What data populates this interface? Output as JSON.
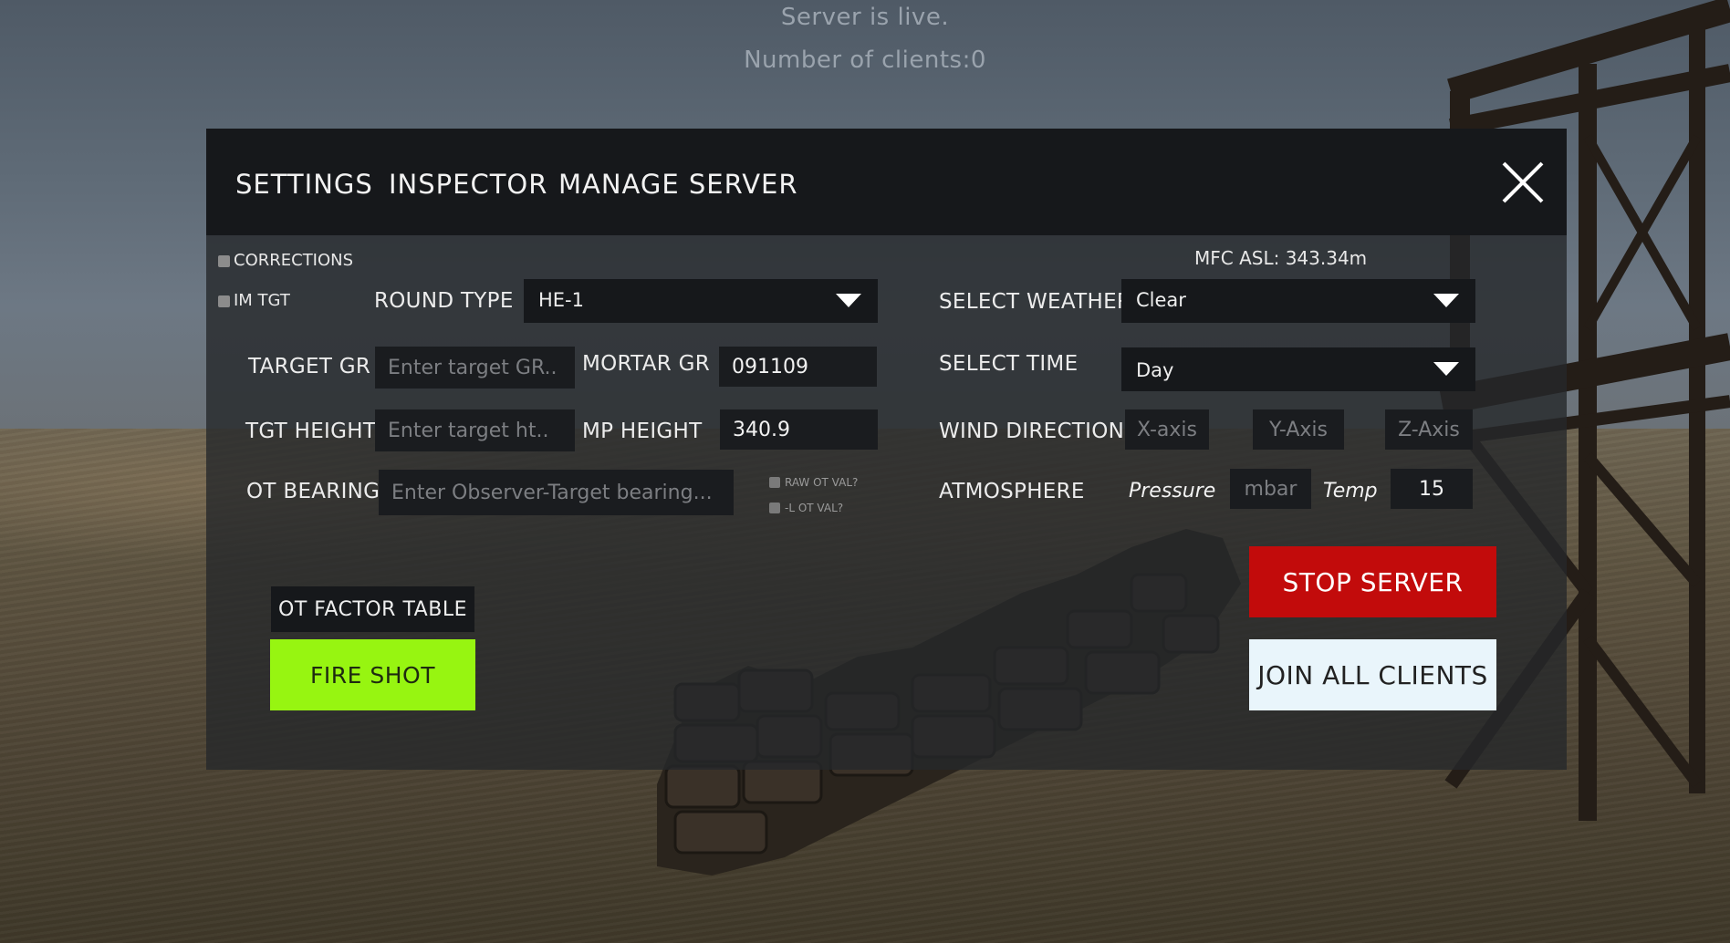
{
  "server": {
    "status": "Server is live.",
    "clients": "Number of clients:0"
  },
  "tabs": {
    "settings": "SETTINGS",
    "inspector": "INSPECTOR",
    "manage_server": "MANAGE SERVER"
  },
  "left": {
    "corrections_label": "CORRECTIONS",
    "im_tgt_label": "IM TGT",
    "round_type_label": "ROUND TYPE",
    "round_type_value": "HE-1",
    "target_gr_label": "TARGET GR",
    "target_gr_placeholder": "Enter target GR..",
    "mortar_gr_label": "MORTAR GR",
    "mortar_gr_value": "091109",
    "tgt_height_label": "TGT HEIGHT",
    "tgt_height_placeholder": "Enter target ht..",
    "mp_height_label": "MP HEIGHT",
    "mp_height_value": "340.9",
    "ot_bearing_label": "OT BEARING",
    "ot_bearing_placeholder": "Enter Observer-Target bearing...",
    "raw_ot_val_label": "RAW OT VAL?",
    "l_ot_val_label": "-L OT VAL?"
  },
  "right": {
    "mfc_asl": "MFC ASL: 343.34m",
    "select_weather_label": "SELECT WEATHER",
    "weather_value": "Clear",
    "select_time_label": "SELECT TIME",
    "time_value": "Day",
    "wind_direction_label": "WIND DIRECTION",
    "wind_x_placeholder": "X-axis",
    "wind_y_placeholder": "Y-Axis",
    "wind_z_placeholder": "Z-Axis",
    "atmosphere_label": "ATMOSPHERE",
    "pressure_label": "Pressure",
    "pressure_placeholder": "mbar",
    "temp_label": "Temp",
    "temp_value": "15"
  },
  "buttons": {
    "ot_factor_table": "OT FACTOR TABLE",
    "fire_shot": "FIRE SHOT",
    "stop_server": "STOP SERVER",
    "join_all_clients": "JOIN ALL CLIENTS"
  },
  "colors": {
    "fire_shot": "#97f511",
    "stop_server": "#c20b0b",
    "join_all_clients": "#e9f5fb",
    "header": "#16181b"
  },
  "icons": {
    "close": "close-icon",
    "dropdown": "chevron-down-icon"
  }
}
